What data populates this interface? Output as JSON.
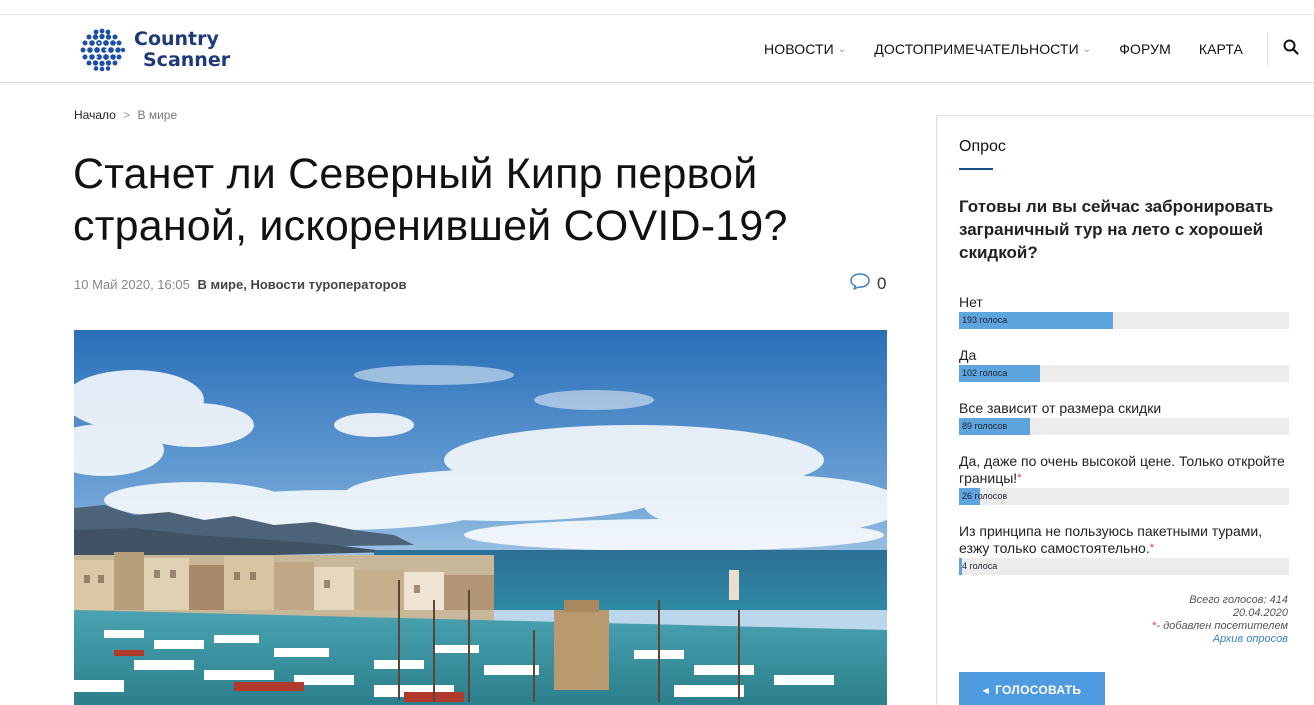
{
  "site": {
    "logo_line1": "Country",
    "logo_line2": "Scanner"
  },
  "nav": {
    "items": [
      {
        "label": "НОВОСТИ",
        "dropdown": true
      },
      {
        "label": "ДОСТОПРИМЕЧАТЕЛЬНОСТИ",
        "dropdown": true
      },
      {
        "label": "ФОРУМ",
        "dropdown": false
      },
      {
        "label": "КАРТА",
        "dropdown": false
      }
    ],
    "search_icon": "search-icon"
  },
  "breadcrumb": {
    "home": "Начало",
    "separator": ">",
    "current": "В мире"
  },
  "article": {
    "title": "Станет ли Северный Кипр первой страной, искоренившей COVID-19?",
    "date": "10 Май 2020, 16:05",
    "categories": "В мире, Новости туроператоров",
    "comment_count": "0",
    "comment_icon": "comment-icon",
    "image_alt": "harbour-photo"
  },
  "poll": {
    "heading": "Опрос",
    "question": "Готовы ли вы сейчас забронировать заграничный тур на лето с хорошей скидкой?",
    "options": [
      {
        "label": "Нет",
        "votes_text": "193 голоса",
        "fraction": 0.466,
        "visitor_added": false
      },
      {
        "label": "Да",
        "votes_text": "102 голоса",
        "fraction": 0.246,
        "visitor_added": false
      },
      {
        "label": "Все зависит от размера скидки",
        "votes_text": "89 голосов",
        "fraction": 0.215,
        "visitor_added": false
      },
      {
        "label": "Да, даже по очень высокой цене. Только откройте границы!",
        "votes_text": "26 голосов",
        "fraction": 0.063,
        "visitor_added": true
      },
      {
        "label": "Из принципа не пользуюсь пакетными турами, езжу только самостоятельно.",
        "votes_text": "4 голоса",
        "fraction": 0.01,
        "visitor_added": true
      }
    ],
    "total_text": "Всего голосов: 414",
    "date_text": "20.04.2020",
    "visitor_note": "- добавлен посетителем",
    "star": "*",
    "archive_link": "Архив опросов",
    "vote_button": "ГОЛОСОВАТЬ",
    "accent_color": "#5ea5de"
  }
}
